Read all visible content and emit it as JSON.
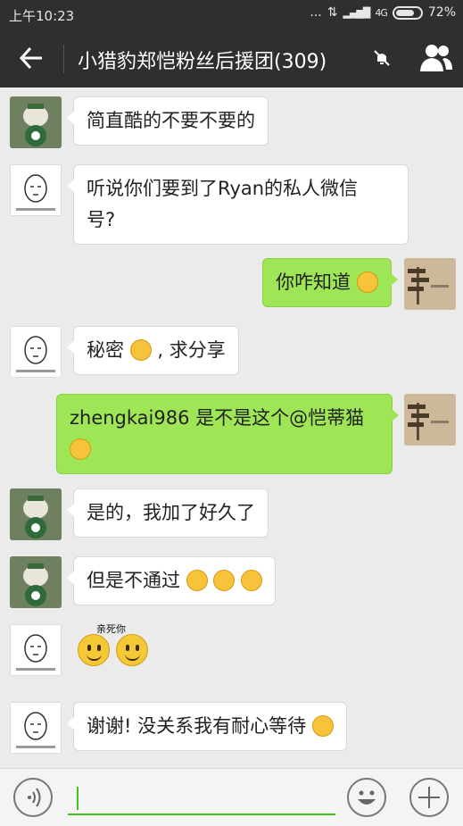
{
  "status_bar": {
    "time": "上午10:23",
    "dots": "...",
    "network": "4G",
    "battery": "72%"
  },
  "header": {
    "title": "小猎豹郑恺粉丝后援团(309)"
  },
  "messages": [
    {
      "text": "简直酷的不要不要的"
    },
    {
      "line1": "听说你们要到了Ryan的私人微信",
      "line2": "号?"
    },
    {
      "text": "你咋知道"
    },
    {
      "text": "秘密",
      "suffix": ", 求分享"
    },
    {
      "line1": "zhengkai986 是不是这个@恺蒂猫"
    },
    {
      "text": "是的，我加了好久了"
    },
    {
      "text": "但是不通过"
    },
    {
      "sticker_label": "亲死你"
    },
    {
      "text": "谢谢! 没关系我有耐心等待"
    }
  ],
  "input": {
    "value": "",
    "placeholder": ""
  },
  "colors": {
    "header_bg": "#2f2f2f",
    "chat_bg": "#ebebeb",
    "outgoing_bubble": "#9ee655",
    "accent": "#45c01a"
  }
}
